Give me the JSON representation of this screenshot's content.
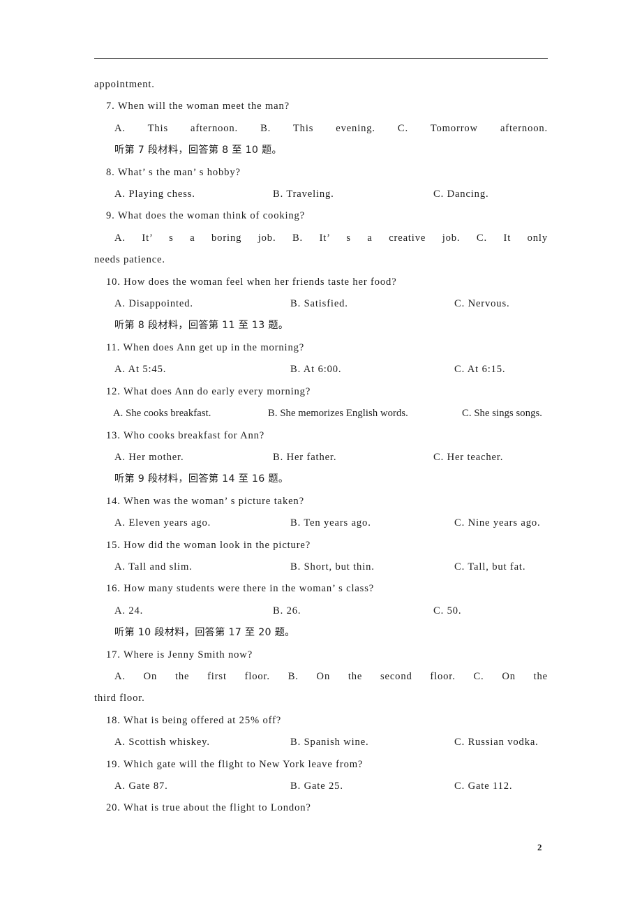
{
  "document": {
    "page_number": "2",
    "opening_fragment": "appointment."
  },
  "blocks": [
    {
      "kind": "question",
      "number": "7.",
      "stem": "7.  When will the woman meet the man?",
      "options": {
        "a": "A. This afternoon.",
        "b": "B. This evening.",
        "c": "C. Tomorrow afternoon."
      }
    },
    {
      "kind": "direction",
      "text": "听第 7 段材料，回答第 8 至 10 题。"
    },
    {
      "kind": "question",
      "number": "8.",
      "stem": "8. What’ s the man’ s hobby?",
      "options": {
        "a": "A. Playing chess.",
        "b": "B. Traveling.",
        "c": "C. Dancing."
      }
    },
    {
      "kind": "question",
      "number": "9.",
      "stem": "9. What does the woman think of cooking?",
      "options": {
        "a": "A. It’ s a boring job.",
        "b": "B. It’ s a creative job.",
        "c": "C.  It  only"
      },
      "continuation": "needs patience."
    },
    {
      "kind": "question",
      "number": "10.",
      "stem": "10. How does the woman feel when her friends taste her food?",
      "options": {
        "a": "A. Disappointed.",
        "b": "B. Satisfied.",
        "c": "C. Nervous."
      }
    },
    {
      "kind": "direction",
      "text": "听第 8 段材料，回答第 11 至 13 题。"
    },
    {
      "kind": "question",
      "number": "11.",
      "stem": "11. When does Ann get up in the morning?",
      "options": {
        "a": "A. At 5:45.",
        "b": "B. At 6:00.",
        "c": "C. At 6:15."
      }
    },
    {
      "kind": "question",
      "number": "12.",
      "stem": "12. What does Ann do early every morning?",
      "options": {
        "a": "A. She cooks breakfast.",
        "b": "B. She memorizes English words.",
        "c": "C. She sings songs."
      }
    },
    {
      "kind": "question",
      "number": "13.",
      "stem": "13. Who cooks breakfast for Ann?",
      "options": {
        "a": "A. Her mother.",
        "b": "B. Her father.",
        "c": "C. Her teacher."
      }
    },
    {
      "kind": "direction",
      "text": "听第 9 段材料，回答第 14 至 16 题。"
    },
    {
      "kind": "question",
      "number": "14.",
      "stem": "14. When was the woman’ s picture taken?",
      "options": {
        "a": "A. Eleven years ago.",
        "b": "B. Ten years ago.",
        "c": "C. Nine years ago."
      }
    },
    {
      "kind": "question",
      "number": "15.",
      "stem": "15. How did the woman look in the picture?",
      "options": {
        "a": "A. Tall and slim.",
        "b": "B. Short, but thin.",
        "c": "C. Tall, but fat."
      }
    },
    {
      "kind": "question",
      "number": "16.",
      "stem": "16. How many students were there in the woman’ s class?",
      "options": {
        "a": "A. 24.",
        "b": "B. 26.",
        "c": "C. 50."
      }
    },
    {
      "kind": "direction",
      "text": "听第 10 段材料，回答第 17 至 20 题。"
    },
    {
      "kind": "question",
      "number": "17.",
      "stem": "17. Where is Jenny Smith now?",
      "options": {
        "a": "A. On the first floor.",
        "b": "B. On the second floor.",
        "c": "C.  On  the"
      },
      "continuation": "third floor."
    },
    {
      "kind": "question",
      "number": "18.",
      "stem": "18. What is being offered at 25% off?",
      "options": {
        "a": "A. Scottish whiskey.",
        "b": "B. Spanish wine.",
        "c": "C. Russian vodka."
      }
    },
    {
      "kind": "question",
      "number": "19.",
      "stem": "19. Which gate will the flight to New York leave from?",
      "options": {
        "a": "A. Gate 87.",
        "b": "B. Gate 25.",
        "c": "C. Gate 112."
      }
    },
    {
      "kind": "question",
      "number": "20.",
      "stem": "20. What is true about the flight to London?",
      "options": null
    }
  ]
}
